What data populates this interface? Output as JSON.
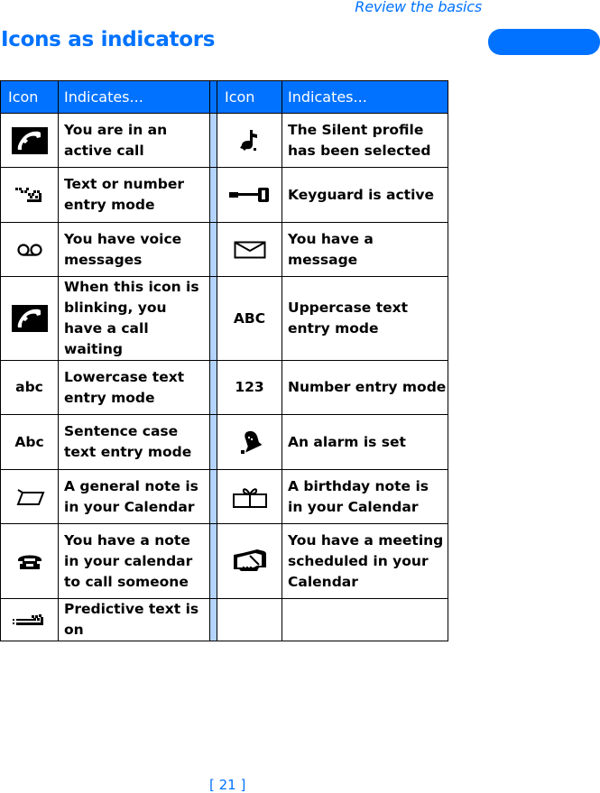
{
  "header": {
    "running_head": "Review the basics",
    "title": "Icons as indicators",
    "accent_color": "#0072ff"
  },
  "table": {
    "columns": [
      "Icon",
      "Indicates...",
      "Icon",
      "Indicates..."
    ],
    "rows": [
      {
        "left": {
          "icon": "active-call-icon",
          "icon_text": "",
          "text": "You are in an active call"
        },
        "right": {
          "icon": "silent-profile-icon",
          "icon_text": "",
          "text": "The Silent profile has been selected"
        }
      },
      {
        "left": {
          "icon": "text-entry-icon",
          "icon_text": "",
          "text": "Text or number entry mode"
        },
        "right": {
          "icon": "keyguard-icon",
          "icon_text": "",
          "text": "Keyguard is active"
        }
      },
      {
        "left": {
          "icon": "voice-message-icon",
          "icon_text": "",
          "text": "You have voice messages"
        },
        "right": {
          "icon": "envelope-icon",
          "icon_text": "",
          "text": "You have a message"
        }
      },
      {
        "left": {
          "icon": "call-waiting-icon",
          "icon_text": "",
          "text": "When this icon is blinking, you have a call waiting"
        },
        "right": {
          "icon": "uppercase-icon",
          "icon_text": "ABC",
          "text": "Uppercase text entry mode"
        }
      },
      {
        "left": {
          "icon": "lowercase-icon",
          "icon_text": "abc",
          "text": "Lowercase text entry mode"
        },
        "right": {
          "icon": "number-mode-icon",
          "icon_text": "123",
          "text": "Number entry mode"
        }
      },
      {
        "left": {
          "icon": "sentence-case-icon",
          "icon_text": "Abc",
          "text": "Sentence case text entry mode"
        },
        "right": {
          "icon": "alarm-bell-icon",
          "icon_text": "",
          "text": "An alarm is set"
        }
      },
      {
        "left": {
          "icon": "general-note-icon",
          "icon_text": "",
          "text": "A general note is in your Calendar"
        },
        "right": {
          "icon": "birthday-gift-icon",
          "icon_text": "",
          "text": "A birthday note is in your Calendar"
        }
      },
      {
        "left": {
          "icon": "call-note-phone-icon",
          "icon_text": "",
          "text": "You have a note in your calendar to call someone"
        },
        "right": {
          "icon": "meeting-handshake-icon",
          "icon_text": "",
          "text": "You have a meeting scheduled in your Calendar"
        }
      },
      {
        "left": {
          "icon": "predictive-text-icon",
          "icon_text": "",
          "text": "Predictive text is on"
        },
        "right": {
          "icon": "",
          "icon_text": "",
          "text": ""
        }
      }
    ]
  },
  "footer": {
    "page_number": "[ 21 ]"
  }
}
